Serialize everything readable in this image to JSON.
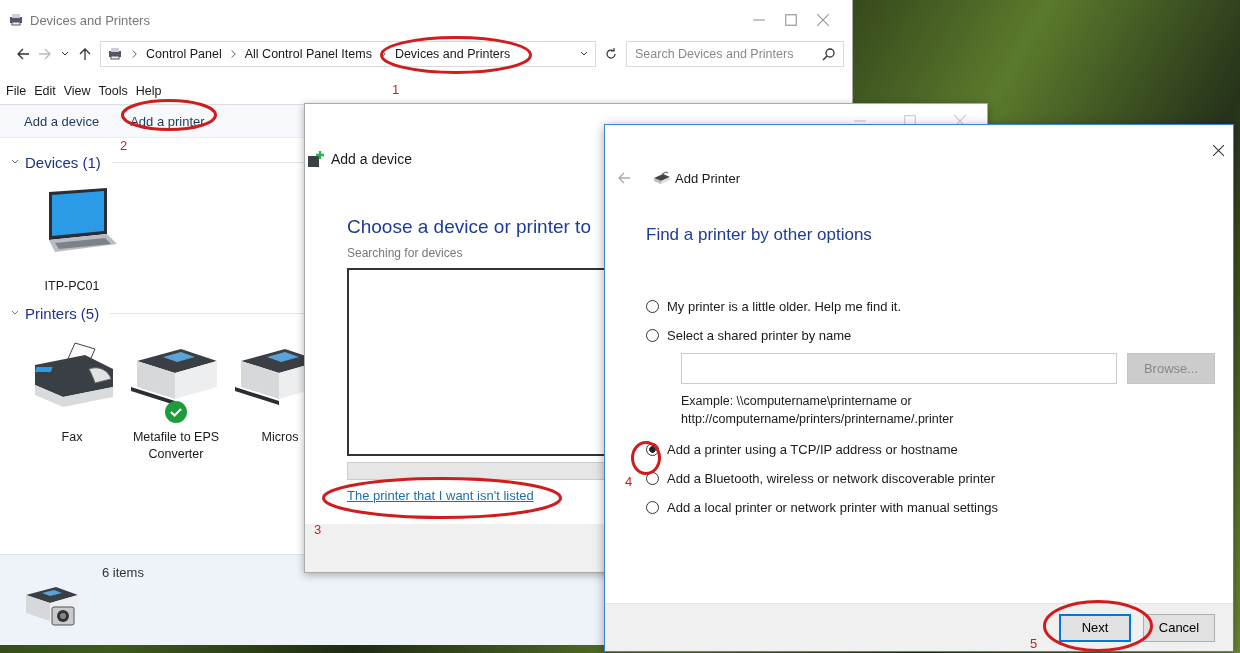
{
  "explorer": {
    "title": "Devices and Printers",
    "breadcrumb": [
      "Control Panel",
      "All Control Panel Items",
      "Devices and Printers"
    ],
    "search": {
      "placeholder": "Search Devices and Printers"
    },
    "menu": [
      "File",
      "Edit",
      "View",
      "Tools",
      "Help"
    ],
    "commands": [
      "Add a device",
      "Add a printer"
    ],
    "groups": [
      {
        "title": "Devices (1)",
        "expanded": true,
        "items": [
          {
            "kind": "laptop",
            "label": "ITP-PC01",
            "default": false
          }
        ]
      },
      {
        "title": "Printers (5)",
        "expanded": true,
        "items": [
          {
            "kind": "fax",
            "label": "Fax",
            "default": false
          },
          {
            "kind": "printer",
            "label": "Metafile to EPS Converter",
            "default": true
          },
          {
            "kind": "printer",
            "label": "Micros",
            "default": false
          }
        ]
      }
    ],
    "status": "6 items"
  },
  "add_device_dialog": {
    "title": "Add a device",
    "heading": "Choose a device or printer to",
    "status": "Searching for devices",
    "link": "The printer that I want isn't listed"
  },
  "add_printer_dialog": {
    "title": "Add Printer",
    "heading": "Find a printer by other options",
    "options": [
      {
        "label": "My printer is a little older. Help me find it.",
        "selected": false
      },
      {
        "label": "Select a shared printer by name",
        "selected": false
      },
      {
        "label": "Add a printer using a TCP/IP address or hostname",
        "selected": true
      },
      {
        "label": "Add a Bluetooth, wireless or network discoverable printer",
        "selected": false
      },
      {
        "label": "Add a local printer or network printer with manual settings",
        "selected": false
      }
    ],
    "browse": {
      "label": "Browse...",
      "disabled": true
    },
    "example": "Example: \\\\computername\\printername or http://computername/printers/printername/.printer",
    "buttons": [
      {
        "label": "Next",
        "default": true
      },
      {
        "label": "Cancel",
        "default": false
      }
    ]
  },
  "annotations": [
    {
      "label": "1"
    },
    {
      "label": "2"
    },
    {
      "label": "3"
    },
    {
      "label": "4"
    },
    {
      "label": "5"
    }
  ]
}
